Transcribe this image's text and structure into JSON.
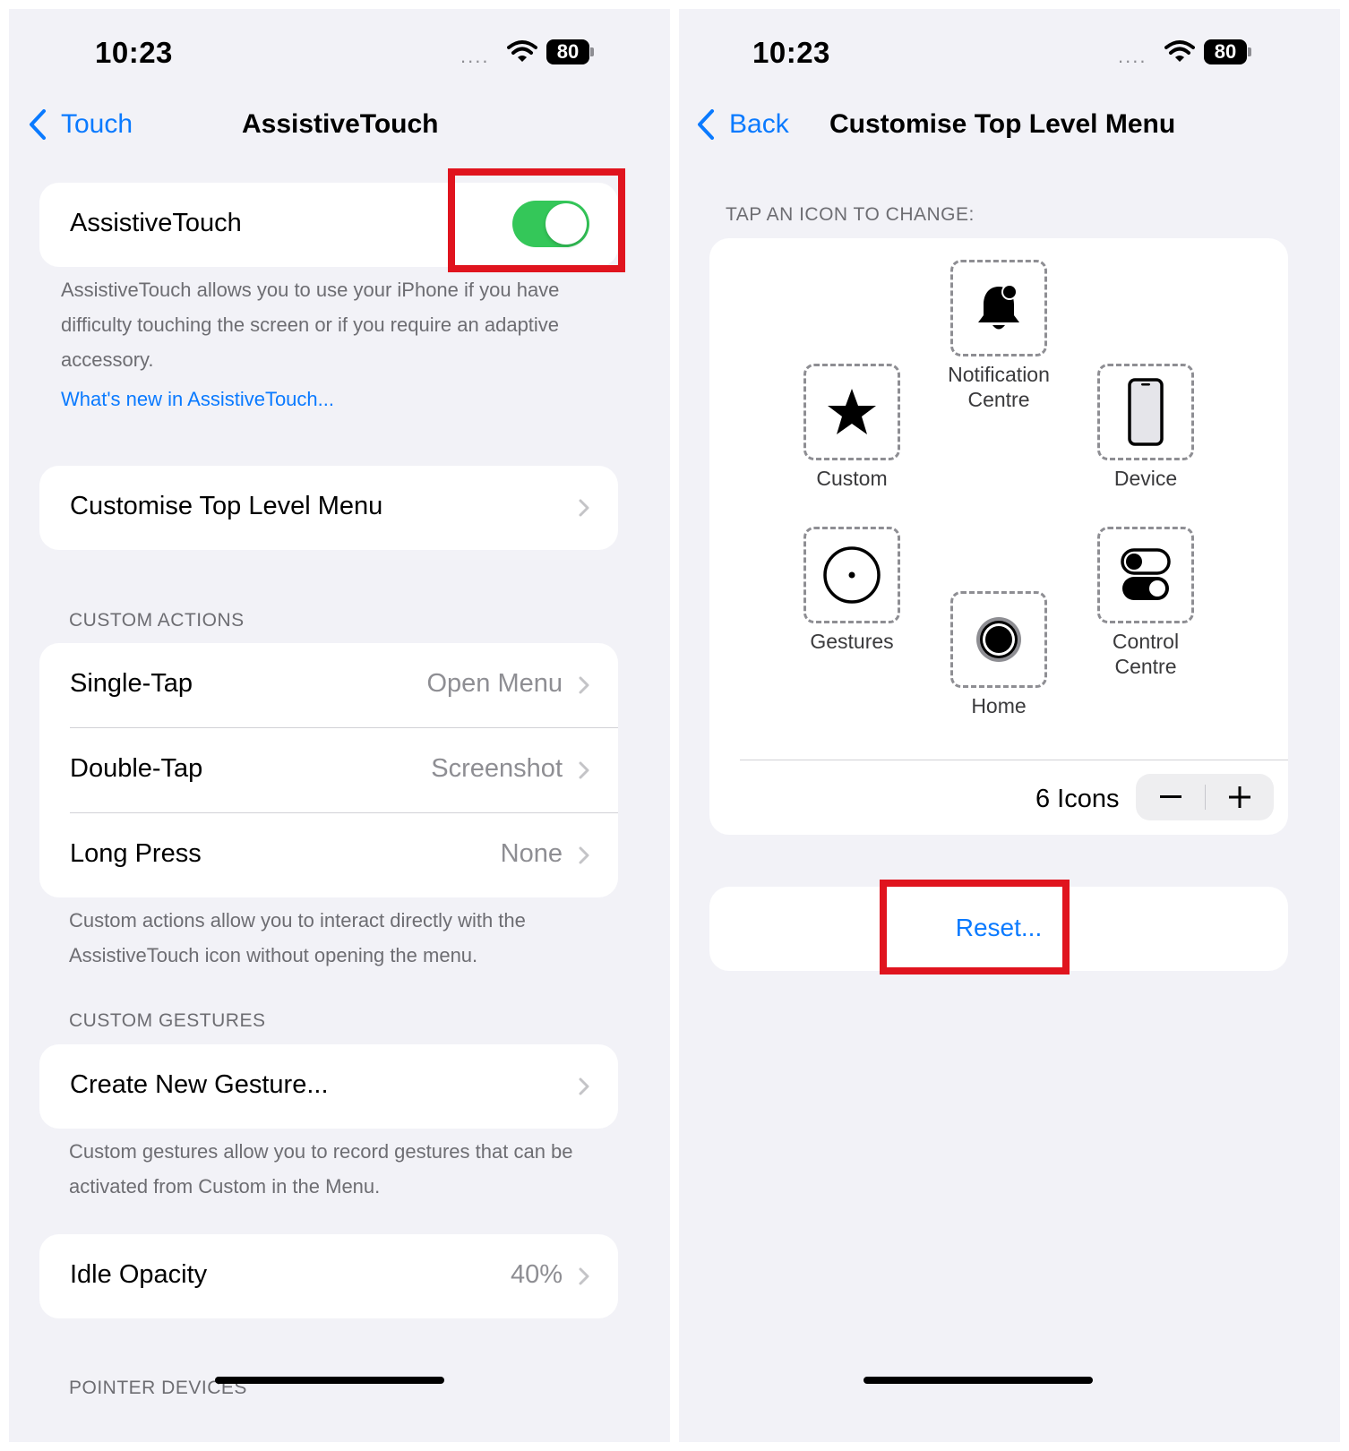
{
  "left": {
    "status": {
      "time": "10:23",
      "signal": "....",
      "battery": "80"
    },
    "nav": {
      "back_label": "Touch",
      "title": "AssistiveTouch"
    },
    "assistive_row": {
      "label": "AssistiveTouch",
      "toggle_on": true
    },
    "assistive_footer": "AssistiveTouch allows you to use your iPhone if you have difficulty touching the screen or if you require an adaptive accessory.",
    "whats_new_link": "What's new in AssistiveTouch...",
    "customise_row": {
      "label": "Customise Top Level Menu"
    },
    "custom_actions": {
      "header": "CUSTOM ACTIONS",
      "rows": [
        {
          "label": "Single-Tap",
          "value": "Open Menu"
        },
        {
          "label": "Double-Tap",
          "value": "Screenshot"
        },
        {
          "label": "Long Press",
          "value": "None"
        }
      ],
      "footer": "Custom actions allow you to interact directly with the AssistiveTouch icon without opening the menu."
    },
    "custom_gestures": {
      "header": "CUSTOM GESTURES",
      "row_label": "Create New Gesture...",
      "footer": "Custom gestures allow you to record gestures that can be activated from Custom in the Menu."
    },
    "idle_opacity": {
      "label": "Idle Opacity",
      "value": "40%"
    },
    "pointer_header": "POINTER DEVICES"
  },
  "right": {
    "status": {
      "time": "10:23",
      "signal": "....",
      "battery": "80"
    },
    "nav": {
      "back_label": "Back",
      "title": "Customise Top Level Menu"
    },
    "section_header": "TAP AN ICON TO CHANGE:",
    "icons": {
      "notification": {
        "label_1": "Notification",
        "label_2": "Centre",
        "icon": "bell-icon"
      },
      "custom": {
        "label": "Custom",
        "icon": "star-icon"
      },
      "device": {
        "label": "Device",
        "icon": "iphone-icon"
      },
      "gestures": {
        "label": "Gestures",
        "icon": "circle-dot-icon"
      },
      "home": {
        "label": "Home",
        "icon": "home-button-icon"
      },
      "control": {
        "label_1": "Control",
        "label_2": "Centre",
        "icon": "toggles-icon"
      }
    },
    "icon_count_label": "6 Icons",
    "stepper": {
      "minus": "−",
      "plus": "+"
    },
    "reset_label": "Reset..."
  },
  "colors": {
    "accent": "#0a7aff",
    "toggle_on": "#34c759",
    "highlight": "#e0141e",
    "background": "#f2f2f7"
  }
}
